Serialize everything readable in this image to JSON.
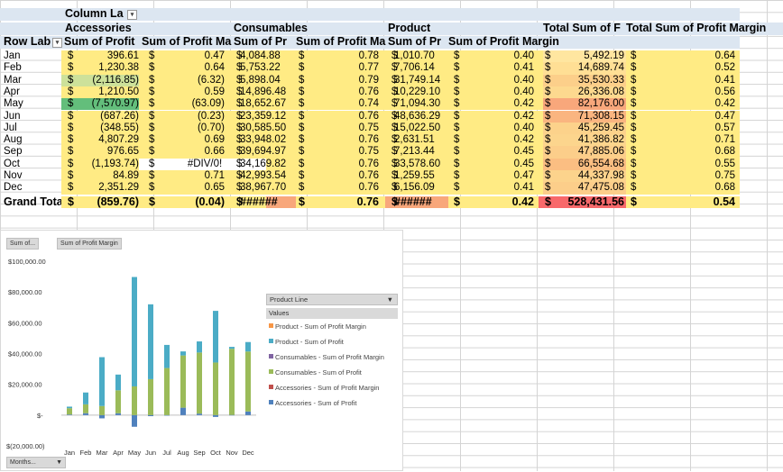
{
  "pivot": {
    "column_labels": "Column La",
    "groups": [
      "Accessories",
      "Consumables",
      "Product"
    ],
    "total_headers": [
      "Total Sum of F",
      "Total Sum of Profit Margin"
    ],
    "row_labels": "Row Lab",
    "sub_headers": [
      "Sum of Profit",
      "Sum of Profit Ma",
      "Sum of Pr",
      "Sum of Profit Ma",
      "Sum of Pr",
      "Sum of Profit Margin"
    ],
    "rows": [
      {
        "m": "Jan",
        "a": "396.61",
        "am": "0.47",
        "c": "4,084.88",
        "cm": "0.78",
        "p": "1,010.70",
        "pm": "0.40",
        "t": "5,492.19",
        "tm": "0.64"
      },
      {
        "m": "Feb",
        "a": "1,230.38",
        "am": "0.64",
        "c": "5,753.22",
        "cm": "0.77",
        "p": "7,706.14",
        "pm": "0.41",
        "t": "14,689.74",
        "tm": "0.52"
      },
      {
        "m": "Mar",
        "a": "(2,116.85)",
        "am": "(6.32)",
        "c": "5,898.04",
        "cm": "0.79",
        "p": "31,749.14",
        "pm": "0.40",
        "t": "35,530.33",
        "tm": "0.41"
      },
      {
        "m": "Apr",
        "a": "1,210.50",
        "am": "0.59",
        "c": "14,896.48",
        "cm": "0.76",
        "p": "10,229.10",
        "pm": "0.40",
        "t": "26,336.08",
        "tm": "0.56"
      },
      {
        "m": "May",
        "a": "(7,570.97)",
        "am": "(63.09)",
        "c": "18,652.67",
        "cm": "0.74",
        "p": "71,094.30",
        "pm": "0.42",
        "t": "82,176.00",
        "tm": "0.42"
      },
      {
        "m": "Jun",
        "a": "(687.26)",
        "am": "(0.23)",
        "c": "23,359.12",
        "cm": "0.76",
        "p": "48,636.29",
        "pm": "0.42",
        "t": "71,308.15",
        "tm": "0.47"
      },
      {
        "m": "Jul",
        "a": "(348.55)",
        "am": "(0.70)",
        "c": "30,585.50",
        "cm": "0.75",
        "p": "15,022.50",
        "pm": "0.40",
        "t": "45,259.45",
        "tm": "0.57"
      },
      {
        "m": "Aug",
        "a": "4,807.29",
        "am": "0.69",
        "c": "33,948.02",
        "cm": "0.76",
        "p": "2,631.51",
        "pm": "0.42",
        "t": "41,386.82",
        "tm": "0.71"
      },
      {
        "m": "Sep",
        "a": "976.65",
        "am": "0.66",
        "c": "39,694.97",
        "cm": "0.75",
        "p": "7,213.44",
        "pm": "0.45",
        "t": "47,885.06",
        "tm": "0.68"
      },
      {
        "m": "Oct",
        "a": "(1,193.74)",
        "am": "#DIV/0!",
        "c": "34,169.82",
        "cm": "0.76",
        "p": "33,578.60",
        "pm": "0.45",
        "t": "66,554.68",
        "tm": "0.55"
      },
      {
        "m": "Nov",
        "a": "84.89",
        "am": "0.71",
        "c": "42,993.54",
        "cm": "0.76",
        "p": "1,259.55",
        "pm": "0.47",
        "t": "44,337.98",
        "tm": "0.75"
      },
      {
        "m": "Dec",
        "a": "2,351.29",
        "am": "0.65",
        "c": "38,967.70",
        "cm": "0.76",
        "p": "6,156.09",
        "pm": "0.41",
        "t": "47,475.08",
        "tm": "0.68"
      }
    ],
    "grand": {
      "m": "Grand Tota",
      "a": "(859.76)",
      "am": "(0.04)",
      "c": "######",
      "cm": "0.76",
      "p": "######",
      "pm": "0.42",
      "t": "528,431.56",
      "tm": "0.54"
    },
    "dollar": "$"
  },
  "chart": {
    "field_buttons": [
      "Sum of...",
      "Sum of Profit Margin"
    ],
    "axis_button": "Months...",
    "y_ticks": [
      "$100,000.00",
      "$80,000.00",
      "$60,000.00",
      "$40,000.00",
      "$20,000.00",
      "$-",
      "$(20,000.00)"
    ],
    "months": [
      "Jan",
      "Feb",
      "Mar",
      "Apr",
      "May",
      "Jun",
      "Jul",
      "Aug",
      "Sep",
      "Oct",
      "Nov",
      "Dec"
    ],
    "legend_title": "Product Line",
    "legend_values": "Values",
    "legend": [
      {
        "label": "Product - Sum of Profit Margin",
        "color": "#f79646"
      },
      {
        "label": "Product - Sum of Profit",
        "color": "#4bacc6"
      },
      {
        "label": "Consumables - Sum of Profit Margin",
        "color": "#8064a2"
      },
      {
        "label": "Consumables - Sum of Profit",
        "color": "#9bbb59"
      },
      {
        "label": "Accessories - Sum of Profit Margin",
        "color": "#c0504d"
      },
      {
        "label": "Accessories - Sum of Profit",
        "color": "#4f81bd"
      }
    ]
  },
  "chart_data": {
    "type": "bar",
    "categories": [
      "Jan",
      "Feb",
      "Mar",
      "Apr",
      "May",
      "Jun",
      "Jul",
      "Aug",
      "Sep",
      "Oct",
      "Nov",
      "Dec"
    ],
    "series": [
      {
        "name": "Accessories - Sum of Profit",
        "values": [
          396.61,
          1230.38,
          -2116.85,
          1210.5,
          -7570.97,
          -687.26,
          -348.55,
          4807.29,
          976.65,
          -1193.74,
          84.89,
          2351.29
        ]
      },
      {
        "name": "Consumables - Sum of Profit",
        "values": [
          4084.88,
          5753.22,
          5898.04,
          14896.48,
          18652.67,
          23359.12,
          30585.5,
          33948.02,
          39694.97,
          34169.82,
          42993.54,
          38967.7
        ]
      },
      {
        "name": "Product - Sum of Profit",
        "values": [
          1010.7,
          7706.14,
          31749.14,
          10229.1,
          71094.3,
          48636.29,
          15022.5,
          2631.51,
          7213.44,
          33578.6,
          1259.55,
          6156.09
        ]
      }
    ],
    "ylim": [
      -20000,
      100000
    ],
    "stacked": true
  }
}
